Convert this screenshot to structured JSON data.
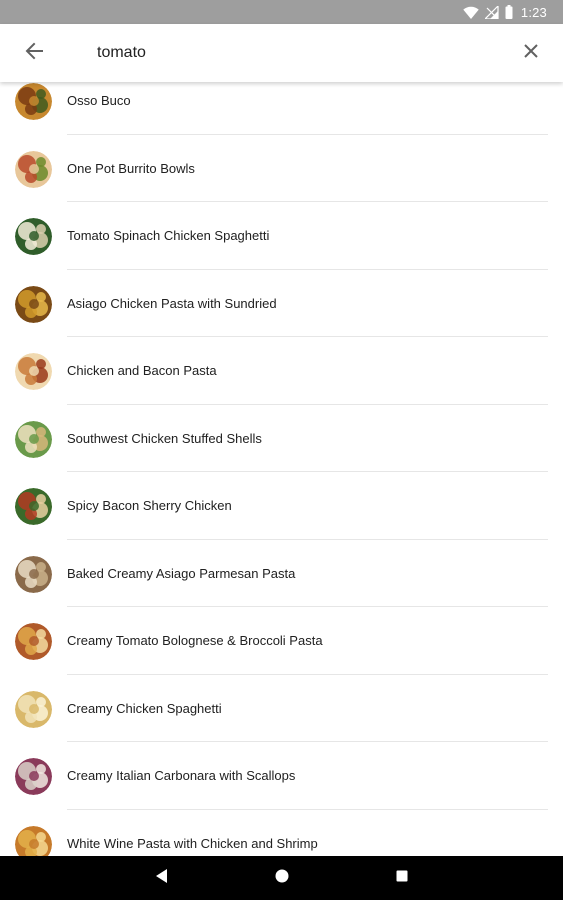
{
  "status_bar": {
    "time": "1:23",
    "icons": [
      "wifi-icon",
      "signal-icon",
      "battery-icon"
    ]
  },
  "search": {
    "query": "tomato",
    "back_icon": "arrow-back-icon",
    "clear_icon": "close-icon"
  },
  "results": [
    {
      "label": "Osso Buco",
      "thumb_colors": [
        "#7a3b12",
        "#c7882f",
        "#3f5a1f"
      ]
    },
    {
      "label": "One Pot Burrito Bowls",
      "thumb_colors": [
        "#b84a2a",
        "#e8c79a",
        "#6b8a2a"
      ]
    },
    {
      "label": "Tomato Spinach Chicken Spaghetti",
      "thumb_colors": [
        "#f2ecd8",
        "#2f5d2a",
        "#d9cfae"
      ]
    },
    {
      "label": "Asiago Chicken Pasta with Sundried",
      "thumb_colors": [
        "#d19a2a",
        "#7a4a16",
        "#e8b84a"
      ]
    },
    {
      "label": "Chicken and Bacon Pasta",
      "thumb_colors": [
        "#c97a3a",
        "#f0d9b0",
        "#9a3a1a"
      ]
    },
    {
      "label": "Southwest Chicken Stuffed Shells",
      "thumb_colors": [
        "#efe2c0",
        "#6a9a4a",
        "#d6b67a"
      ]
    },
    {
      "label": "Spicy Bacon Sherry Chicken",
      "thumb_colors": [
        "#b23a22",
        "#3a6a2a",
        "#e8d0a0"
      ]
    },
    {
      "label": "Baked Creamy Asiago Parmesan Pasta",
      "thumb_colors": [
        "#e9dcc4",
        "#8a6a4a",
        "#c9b08a"
      ]
    },
    {
      "label": "Creamy Tomato Bolognese & Broccoli Pasta",
      "thumb_colors": [
        "#e0a84a",
        "#b05a2a",
        "#f3dba0"
      ]
    },
    {
      "label": "Creamy Chicken Spaghetti",
      "thumb_colors": [
        "#f1e3b8",
        "#d9b86a",
        "#faf2d6"
      ]
    },
    {
      "label": "Creamy Italian Carbonara with Scallops",
      "thumb_colors": [
        "#d8d0c8",
        "#8a3a5a",
        "#f0e8e0"
      ]
    },
    {
      "label": "White Wine Pasta with Chicken and Shrimp",
      "thumb_colors": [
        "#e3b04a",
        "#c67a2a",
        "#f4d890"
      ]
    }
  ],
  "nav_bar": {
    "back_icon": "nav-back-icon",
    "home_icon": "nav-home-icon",
    "recents_icon": "nav-recents-icon"
  }
}
